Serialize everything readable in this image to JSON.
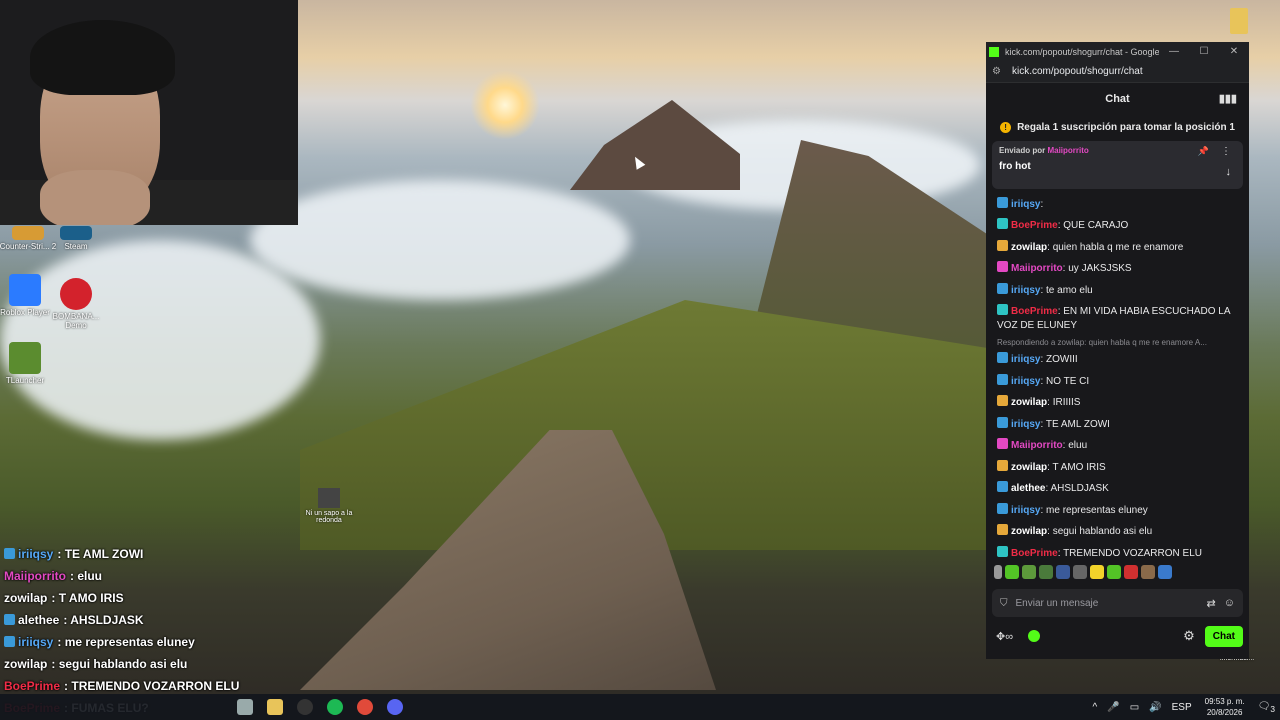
{
  "desktop": {
    "icons": [
      {
        "label": "Counter-Stri... 2",
        "icon": "counter-strike-icon"
      },
      {
        "label": "Steam",
        "icon": "steam-icon"
      },
      {
        "label": "Roblox Player",
        "icon": "roblox-icon"
      },
      {
        "label": "BOMBANA... Demo",
        "icon": "bombana-icon"
      },
      {
        "label": "TLauncher",
        "icon": "tlauncher-icon"
      }
    ],
    "small_overlay": "Ni un sapo a la redonda",
    "right_partial": "informaci..."
  },
  "overlay_chat": [
    {
      "user": "iriiqsy",
      "text": "TE AML ZOWI",
      "color": "#56a8f5",
      "badge": "#3a9ad9"
    },
    {
      "user": "Maiiporrito",
      "text": "eluu",
      "color": "#e349c3",
      "badge": ""
    },
    {
      "user": "zowilap",
      "text": "T AMO IRIS",
      "color": "#ffffff",
      "badge": ""
    },
    {
      "user": "alethee",
      "text": "AHSLDJASK",
      "color": "#ffffff",
      "badge": "#3a9ad9"
    },
    {
      "user": "iriiqsy",
      "text": "me representas eluney",
      "color": "#56a8f5",
      "badge": "#3a9ad9"
    },
    {
      "user": "zowilap",
      "text": "segui hablando asi elu",
      "color": "#ffffff",
      "badge": ""
    },
    {
      "user": "BoePrime",
      "text": "TREMENDO VOZARRON ELU",
      "color": "#f02c47",
      "badge": ""
    },
    {
      "user": "BoePrime",
      "text": "FUMAS ELU?",
      "color": "#f02c47",
      "badge": ""
    }
  ],
  "kick": {
    "window_title": "kick.com/popout/shogurr/chat - Google C...",
    "url": "kick.com/popout/shogurr/chat",
    "header": "Chat",
    "sub_promo": "Regala 1 suscripción para tomar la posición 1",
    "pinned": {
      "label": "Enviado por",
      "user": "Maiiporrito",
      "text": "fro hot"
    },
    "messages": [
      {
        "user": "iriiqsy",
        "text": "",
        "color": "#56a8f5",
        "badge": "#3a9ad9"
      },
      {
        "user": "BoePrime",
        "text": "QUE CARAJO",
        "color": "#f02c47",
        "badge": "#2ec4c4"
      },
      {
        "user": "zowilap",
        "text": "quien habla q me re enamore",
        "color": "#ffffff",
        "badge": "#e6a83a"
      },
      {
        "user": "Maiiporrito",
        "text": "uy JAKSJSKS",
        "color": "#e349c3",
        "badge": "#e349c3"
      },
      {
        "user": "iriiqsy",
        "text": "te amo elu",
        "color": "#56a8f5",
        "badge": "#3a9ad9"
      },
      {
        "user": "BoePrime",
        "text": "EN MI VIDA HABIA ESCUCHADO LA VOZ DE ELUNEY",
        "color": "#f02c47",
        "badge": "#2ec4c4"
      },
      {
        "reply": "Respondiendo a zowilap: quien habla q me re enamore A..."
      },
      {
        "user": "iriiqsy",
        "text": "ZOWIII",
        "color": "#56a8f5",
        "badge": "#3a9ad9"
      },
      {
        "user": "iriiqsy",
        "text": "NO TE CI",
        "color": "#56a8f5",
        "badge": "#3a9ad9"
      },
      {
        "user": "zowilap",
        "text": "IRIIIIS",
        "color": "#ffffff",
        "badge": "#e6a83a"
      },
      {
        "user": "iriiqsy",
        "text": "TE AML ZOWI",
        "color": "#56a8f5",
        "badge": "#3a9ad9"
      },
      {
        "user": "Maiiporrito",
        "text": "eluu",
        "color": "#e349c3",
        "badge": "#e349c3"
      },
      {
        "user": "zowilap",
        "text": "T AMO IRIS",
        "color": "#ffffff",
        "badge": "#e6a83a"
      },
      {
        "user": "alethee",
        "text": "AHSLDJASK",
        "color": "#ffffff",
        "badge": "#3a9ad9"
      },
      {
        "user": "iriiqsy",
        "text": "me representas eluney",
        "color": "#56a8f5",
        "badge": "#3a9ad9"
      },
      {
        "user": "zowilap",
        "text": "segui hablando asi elu",
        "color": "#ffffff",
        "badge": "#e6a83a"
      },
      {
        "user": "BoePrime",
        "text": "TREMENDO VOZARRON ELU",
        "color": "#f02c47",
        "badge": "#2ec4c4"
      },
      {
        "user": "BoePrime",
        "text": "FUMAS ELU?",
        "color": "#f02c47",
        "badge": "#2ec4c4"
      }
    ],
    "input_placeholder": "Enviar un mensaje",
    "chat_button": "Chat",
    "accent": "#53fc18"
  },
  "taskbar": {
    "language": "ESP",
    "time": "09:53 p. m.",
    "date": "20/8/2026",
    "notifications": "3"
  }
}
